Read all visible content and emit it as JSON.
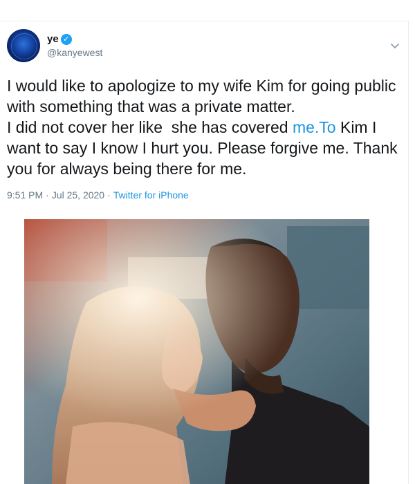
{
  "tweet": {
    "display_name": "ye",
    "verified_glyph": "✓",
    "handle": "@kanyewest",
    "text_parts": {
      "before_link": "I would like to apologize to my wife Kim for going public with something that was a private matter.\nI did not cover her like  she has covered ",
      "link": "me.To",
      "after_link": " Kim I want to say I know I hurt you. Please forgive me. Thank you for always being there for me."
    },
    "time": "9:51 PM",
    "separator": "·",
    "date": "Jul 25, 2020",
    "source": "Twitter for iPhone"
  },
  "icons": {
    "verified": "verified-badge-icon",
    "caret": "chevron-down-icon"
  },
  "colors": {
    "link": "#1b95e0",
    "verified": "#1da1f2",
    "muted": "#657786"
  }
}
